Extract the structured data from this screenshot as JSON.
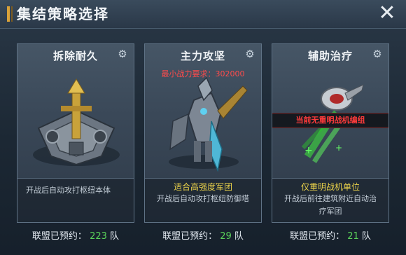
{
  "header": {
    "title": "集结策略选择",
    "close_icon": "close-icon"
  },
  "cards": [
    {
      "title": "拆除耐久",
      "description": "开战后自动攻打枢纽本体",
      "stat_label": "联盟已预约：",
      "stat_value": "223",
      "stat_unit": "队"
    },
    {
      "title": "主力攻坚",
      "requirement": "最小战力要求：302000",
      "highlight": "适合高强度军团",
      "description": "开战后自动攻打枢纽防御塔",
      "stat_label": "联盟已预约：",
      "stat_value": "29",
      "stat_unit": "队"
    },
    {
      "title": "辅助治疗",
      "banner": "当前无重明战机编组",
      "highlight": "仅重明战机单位",
      "description": "开战后前往建筑附近自动治疗军团",
      "stat_label": "联盟已预约：",
      "stat_value": "21",
      "stat_unit": "队"
    }
  ],
  "colors": {
    "accent_gold": "#d9a23a",
    "warning_red": "#ff4b4b",
    "count_green": "#5ad35a",
    "highlight_yellow": "#e8d04a"
  }
}
